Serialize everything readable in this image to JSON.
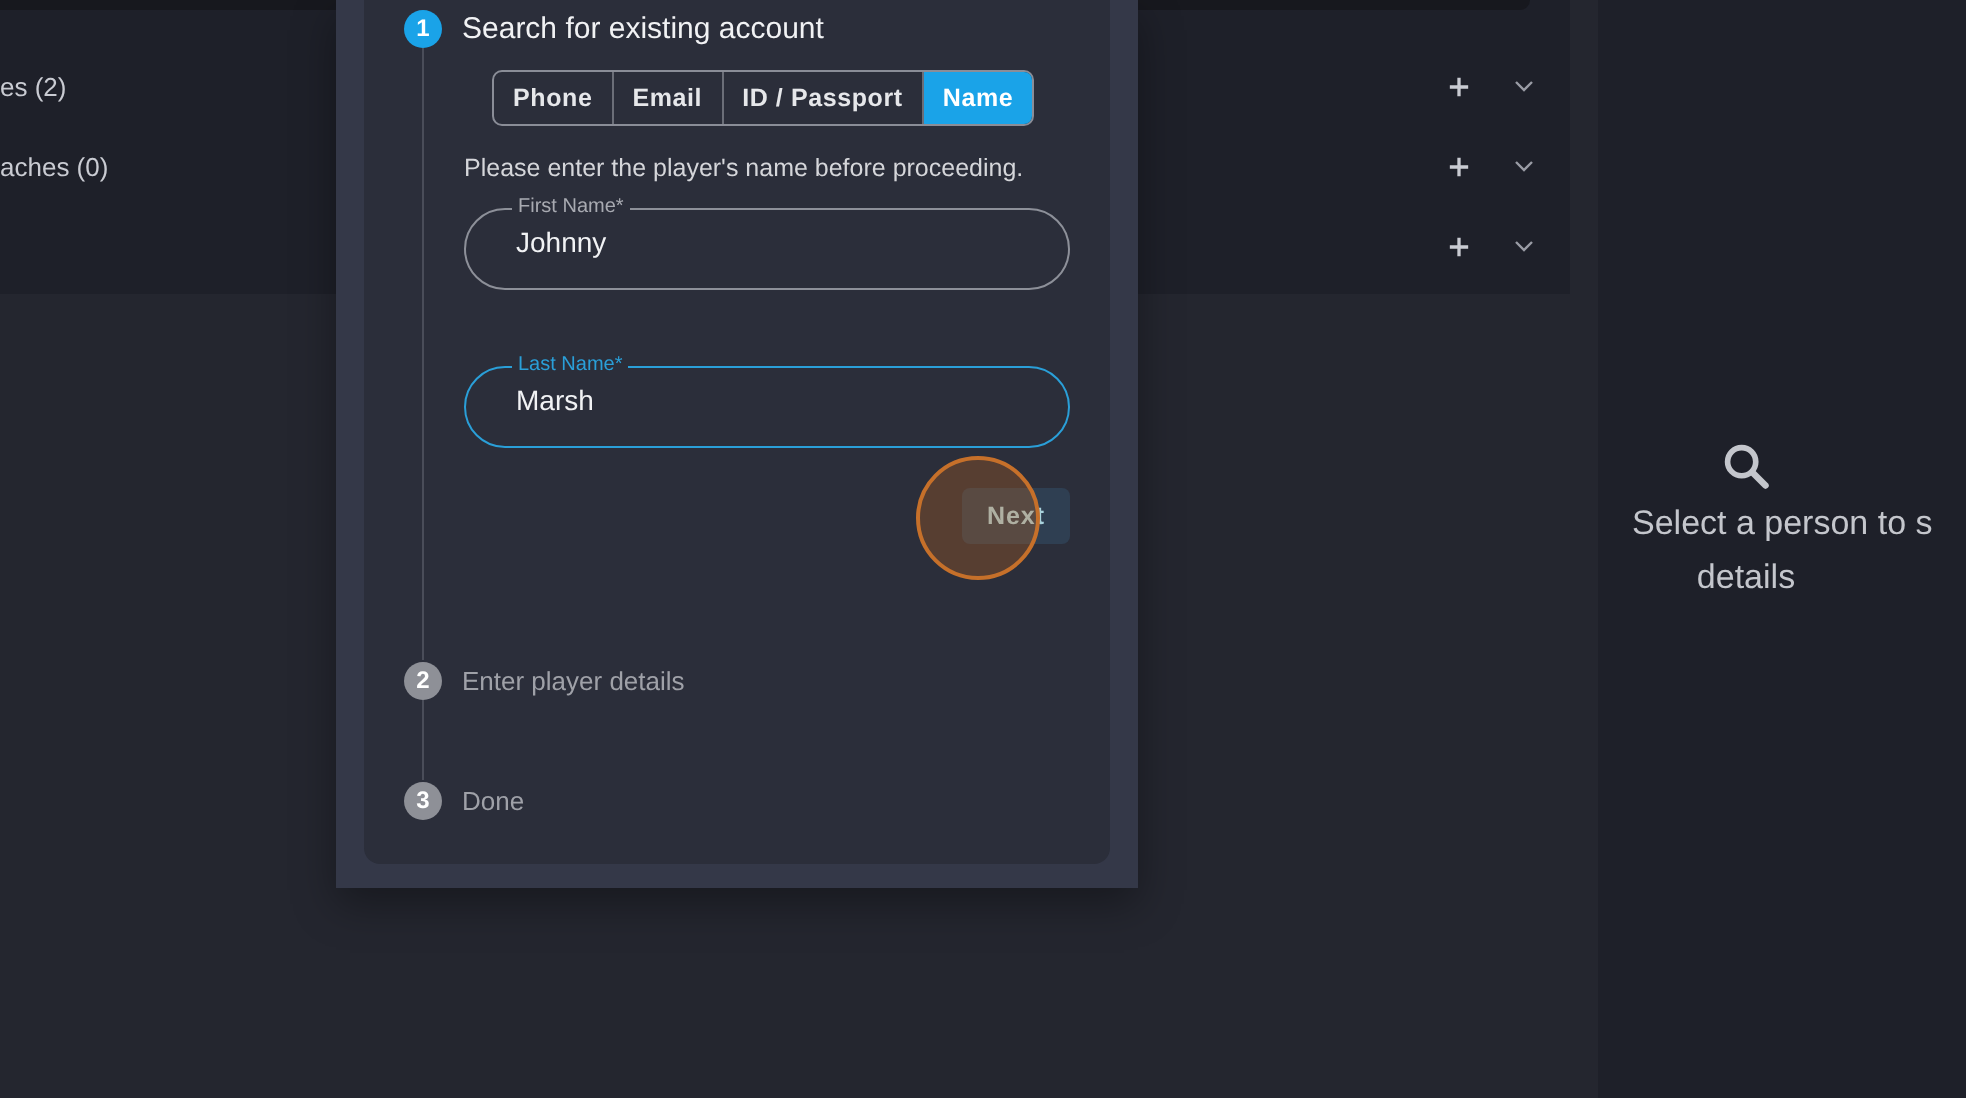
{
  "sections": [
    {
      "label": "es (2)",
      "expanded": false
    },
    {
      "label": "aches (0)",
      "expanded": false
    },
    {
      "expanded": false
    }
  ],
  "dialog": {
    "steps": [
      {
        "number": "1",
        "label": "Search for existing account",
        "active": true
      },
      {
        "number": "2",
        "label": "Enter player details",
        "active": false
      },
      {
        "number": "3",
        "label": "Done",
        "active": false
      }
    ],
    "search_tabs": [
      {
        "label": "Phone",
        "selected": false
      },
      {
        "label": "Email",
        "selected": false
      },
      {
        "label": "ID / Passport",
        "selected": false
      },
      {
        "label": "Name",
        "selected": true
      }
    ],
    "instruction": "Please enter the player's name before proceeding.",
    "fields": [
      {
        "label": "First Name*",
        "value": "Johnny",
        "focused": false
      },
      {
        "label": "Last Name*",
        "value": "Marsh",
        "focused": true
      }
    ],
    "next_button": {
      "label": "Next",
      "disabled": true
    }
  },
  "details_panel": {
    "message_lines": [
      "Select a person to s",
      "details"
    ]
  }
}
